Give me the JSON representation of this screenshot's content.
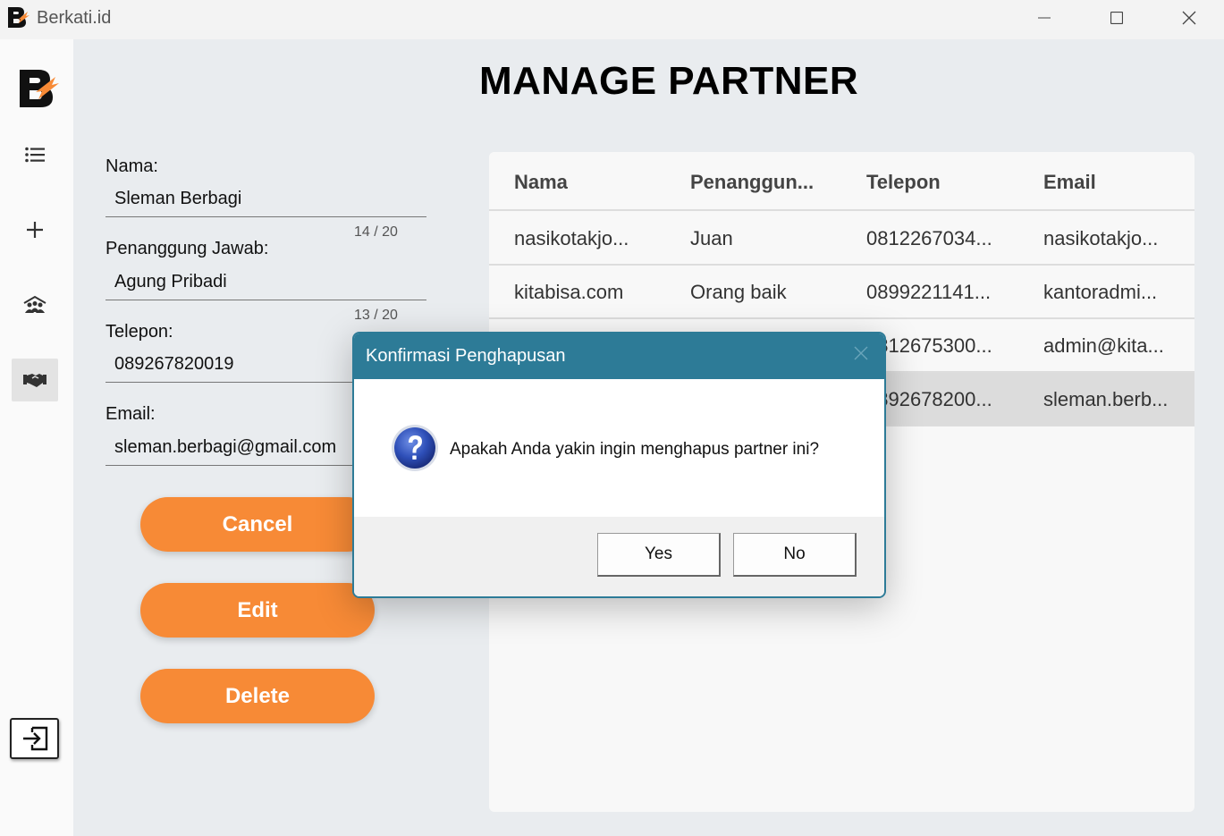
{
  "window": {
    "title": "Berkati.id",
    "minimize_icon": "minimize-icon",
    "maximize_icon": "maximize-icon",
    "close_icon": "close-icon"
  },
  "sidebar": {
    "items": [
      {
        "icon": "list-icon"
      },
      {
        "icon": "plus-icon"
      },
      {
        "icon": "community-icon"
      },
      {
        "icon": "handshake-icon",
        "active": true
      }
    ],
    "logout_icon": "logout-icon"
  },
  "page": {
    "title": "MANAGE PARTNER"
  },
  "form": {
    "nama": {
      "label": "Nama:",
      "value": "Sleman Berbagi",
      "counter": "14 / 20"
    },
    "penanggung": {
      "label": "Penanggung Jawab:",
      "value": "Agung Pribadi",
      "counter": "13 / 20"
    },
    "telepon": {
      "label": "Telepon:",
      "value": "089267820019"
    },
    "email": {
      "label": "Email:",
      "value": "sleman.berbagi@gmail.com"
    }
  },
  "buttons": {
    "cancel": "Cancel",
    "edit": "Edit",
    "delete": "Delete"
  },
  "table": {
    "headers": [
      "Nama",
      "Penanggun...",
      "Telepon",
      "Email"
    ],
    "rows": [
      [
        "nasikotakjo...",
        "Juan",
        "0812267034...",
        "nasikotakjo..."
      ],
      [
        "kitabisa.com",
        "Orang baik",
        "0899221141...",
        "kantoradmi..."
      ],
      [
        "",
        "",
        "0812675300...",
        "admin@kita..."
      ],
      [
        "",
        "",
        "0892678200...",
        "sleman.berb..."
      ]
    ]
  },
  "dialog": {
    "title": "Konfirmasi Penghapusan",
    "message": "Apakah Anda yakin ingin menghapus partner ini?",
    "icon": "question-icon",
    "yes": "Yes",
    "no": "No"
  },
  "colors": {
    "accent": "#f78a36",
    "dialog_header": "#2d7b97"
  }
}
